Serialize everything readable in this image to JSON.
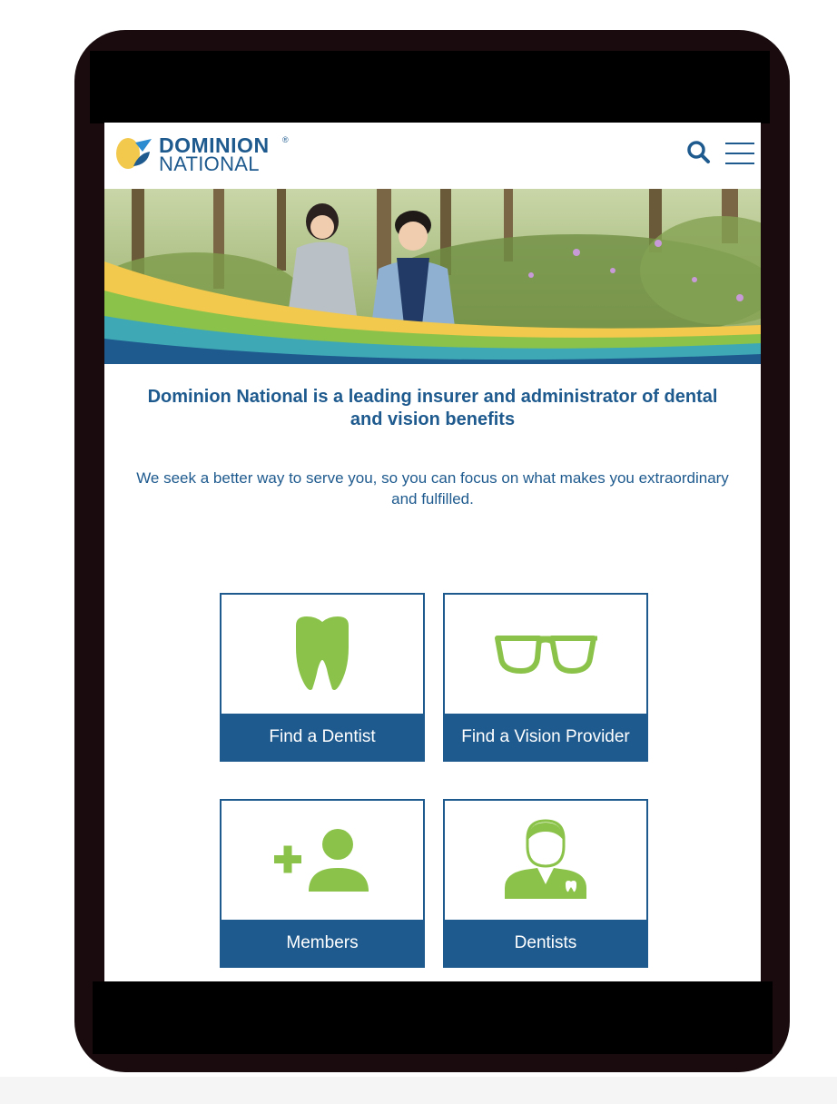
{
  "header": {
    "logo_line1": "DOMINION",
    "logo_line2": "NATIONAL",
    "logo_reg": "®"
  },
  "hero": {
    "image": "children-running-in-forest-illustration"
  },
  "main": {
    "headline": "Dominion National is a leading insurer and administrator of dental and vision benefits",
    "subtext": "We seek a better way to serve you, so you can focus on what makes you extraordinary and fulfilled."
  },
  "tiles": [
    {
      "label": "Find a Dentist",
      "icon": "tooth-icon"
    },
    {
      "label": "Find a Vision Provider",
      "icon": "glasses-icon"
    },
    {
      "label": "Members",
      "icon": "add-member-icon"
    },
    {
      "label": "Dentists",
      "icon": "dentist-icon"
    }
  ],
  "colors": {
    "brand_blue": "#1e5a8e",
    "icon_green": "#8bc34a",
    "logo_yellow": "#f2c94c",
    "device_frame": "#1a0c0e"
  }
}
